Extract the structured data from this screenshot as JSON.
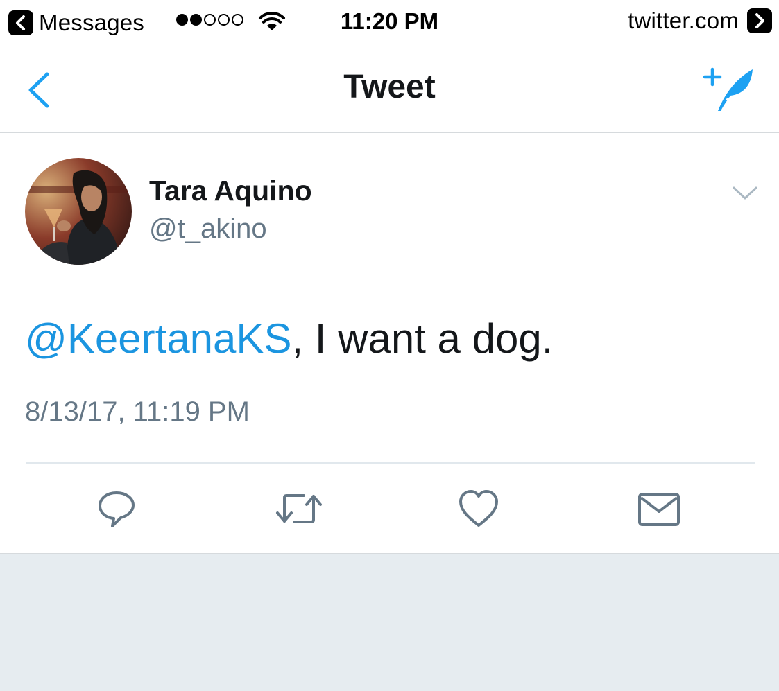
{
  "status_bar": {
    "back_app": "Messages",
    "time": "11:20 PM",
    "domain": "twitter.com",
    "signal": [
      true,
      true,
      false,
      false,
      false
    ]
  },
  "nav": {
    "title": "Tweet",
    "back_icon": "chevron-left-icon",
    "compose_icon": "compose-tweet-icon"
  },
  "tweet": {
    "author": {
      "name": "Tara Aquino",
      "handle": "@t_akino"
    },
    "mention": "@KeertanaKS",
    "body": ", I want a dog.",
    "timestamp": "8/13/17, 11:19 PM",
    "actions": [
      "reply-icon",
      "retweet-icon",
      "like-icon",
      "direct-message-icon"
    ]
  },
  "colors": {
    "accent": "#1da1f2",
    "mention": "#1b95e0",
    "secondary_text": "#657786",
    "icon": "#657786",
    "background": "#e6ecf0"
  }
}
